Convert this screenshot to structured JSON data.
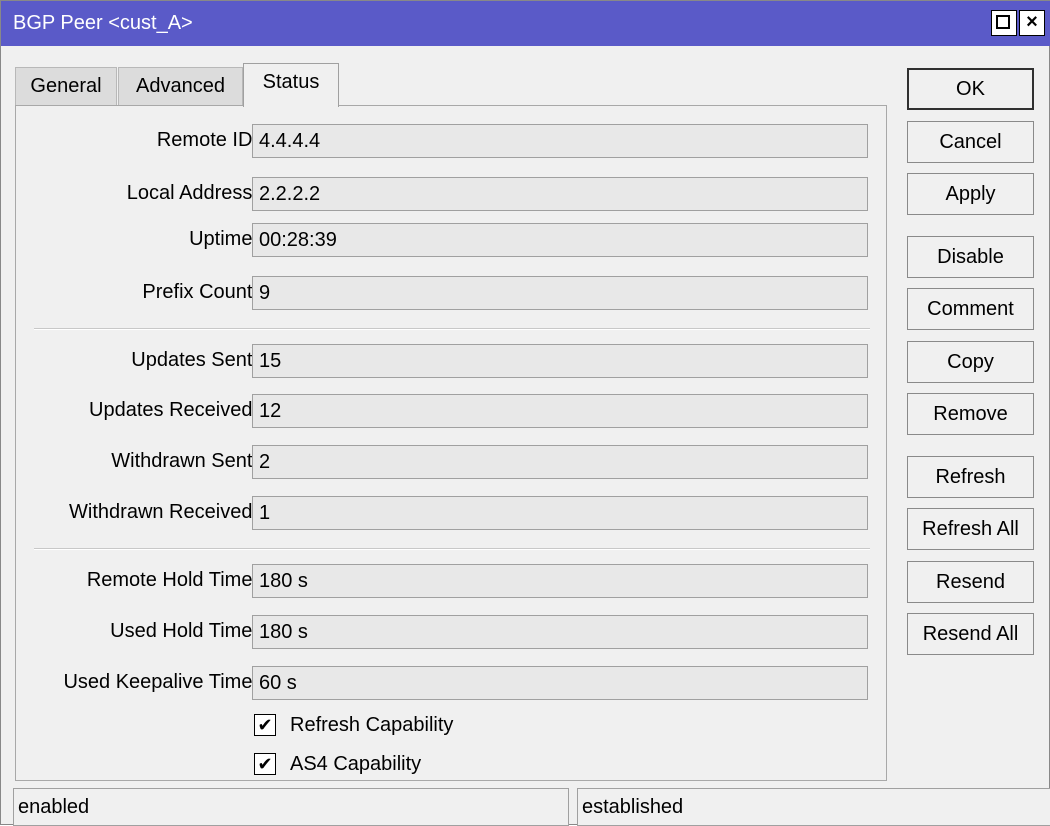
{
  "window": {
    "title": "BGP Peer <cust_A>",
    "maximize_label": "",
    "close_label": "×"
  },
  "tabs": [
    {
      "label": "General"
    },
    {
      "label": "Advanced"
    },
    {
      "label": "Status",
      "active": true
    }
  ],
  "fields": {
    "remote_id": {
      "label": "Remote ID:",
      "value": "4.4.4.4"
    },
    "local_address": {
      "label": "Local Address:",
      "value": "2.2.2.2"
    },
    "uptime": {
      "label": "Uptime:",
      "value": "00:28:39"
    },
    "prefix_count": {
      "label": "Prefix Count:",
      "value": "9"
    },
    "updates_sent": {
      "label": "Updates Sent:",
      "value": "15"
    },
    "updates_received": {
      "label": "Updates Received:",
      "value": "12"
    },
    "withdrawn_sent": {
      "label": "Withdrawn Sent:",
      "value": "2"
    },
    "withdrawn_received": {
      "label": "Withdrawn Received:",
      "value": "1"
    },
    "remote_hold_time": {
      "label": "Remote Hold Time:",
      "value": "180 s"
    },
    "used_hold_time": {
      "label": "Used Hold Time:",
      "value": "180 s"
    },
    "used_keepalive_time": {
      "label": "Used Keepalive Time:",
      "value": "60 s"
    }
  },
  "checkboxes": {
    "refresh_capability": {
      "label": "Refresh Capability",
      "checked": true,
      "mark": "✔"
    },
    "as4_capability": {
      "label": "AS4 Capability",
      "checked": true,
      "mark": "✔"
    }
  },
  "buttons": {
    "ok": "OK",
    "cancel": "Cancel",
    "apply": "Apply",
    "disable": "Disable",
    "comment": "Comment",
    "copy": "Copy",
    "remove": "Remove",
    "refresh": "Refresh",
    "refresh_all": "Refresh All",
    "resend": "Resend",
    "resend_all": "Resend All"
  },
  "statusbar": {
    "left": "enabled",
    "right": "established"
  },
  "colors": {
    "titlebar": "#5a5ac8",
    "window_bg": "#f0f0f0",
    "field_bg": "#e8e8e8"
  }
}
